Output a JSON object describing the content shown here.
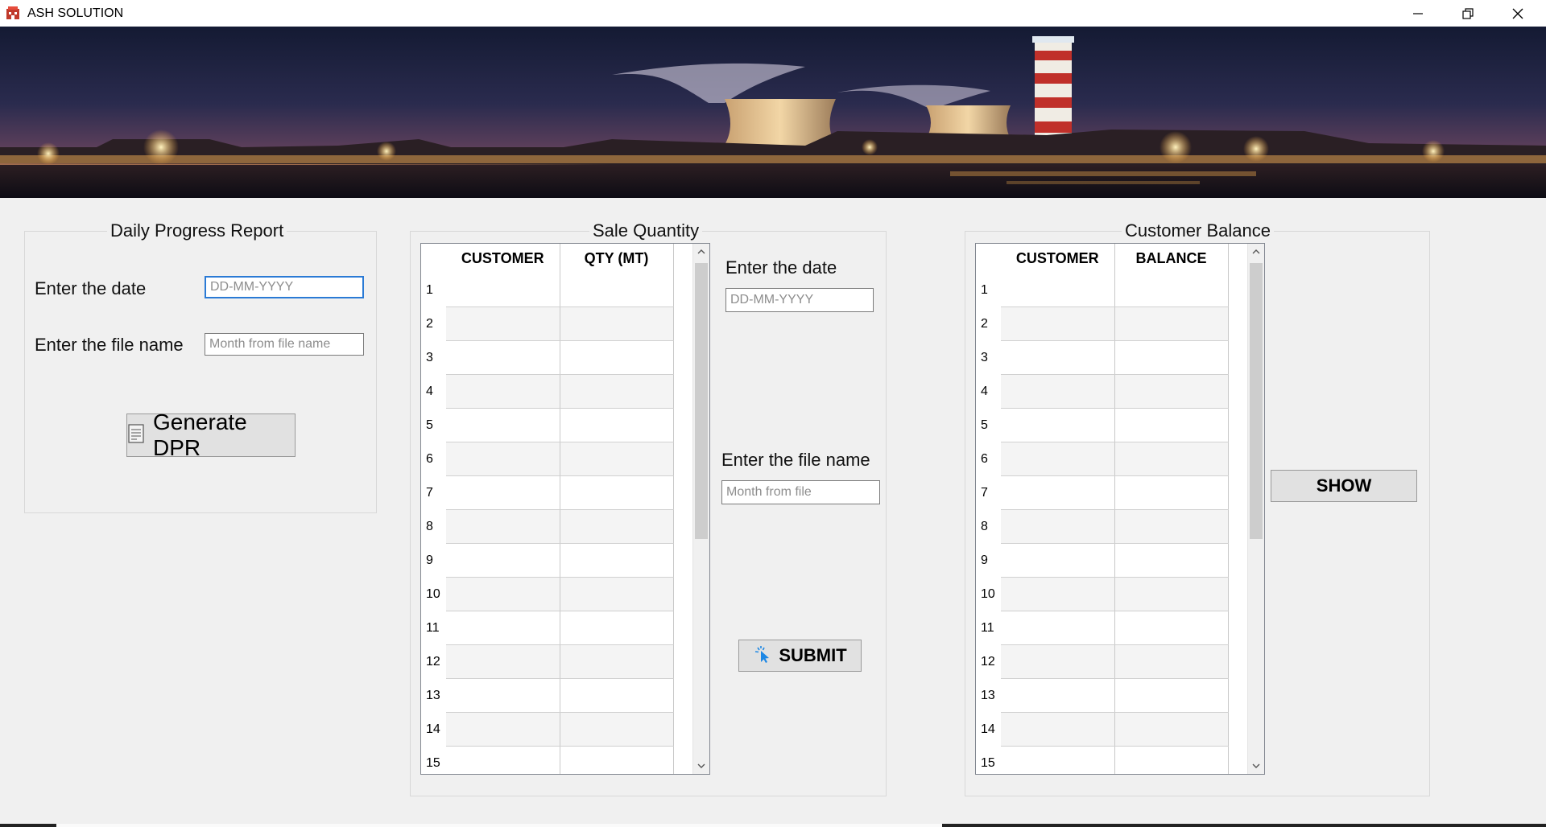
{
  "window": {
    "title": "ASH SOLUTION"
  },
  "dpr": {
    "title": "Daily Progress Report",
    "date_label": "Enter the date",
    "date_placeholder": "DD-MM-YYYY",
    "file_label": "Enter the file name",
    "file_placeholder": "Month from file name",
    "generate_label": "Generate DPR"
  },
  "sale": {
    "title": "Sale Quantity",
    "columns": [
      "CUSTOMER",
      "QTY (MT)"
    ],
    "rows": [
      "1",
      "2",
      "3",
      "4",
      "5",
      "6",
      "7",
      "8",
      "9",
      "10",
      "11",
      "12",
      "13",
      "14",
      "15"
    ],
    "date_label": "Enter the date",
    "date_placeholder": "DD-MM-YYYY",
    "file_label": "Enter the file name",
    "file_placeholder": "Month from file",
    "submit_label": "SUBMIT"
  },
  "balance": {
    "title": "Customer Balance",
    "columns": [
      "CUSTOMER",
      "BALANCE"
    ],
    "rows": [
      "1",
      "2",
      "3",
      "4",
      "5",
      "6",
      "7",
      "8",
      "9",
      "10",
      "11",
      "12",
      "13",
      "14",
      "15"
    ],
    "show_label": "SHOW"
  }
}
